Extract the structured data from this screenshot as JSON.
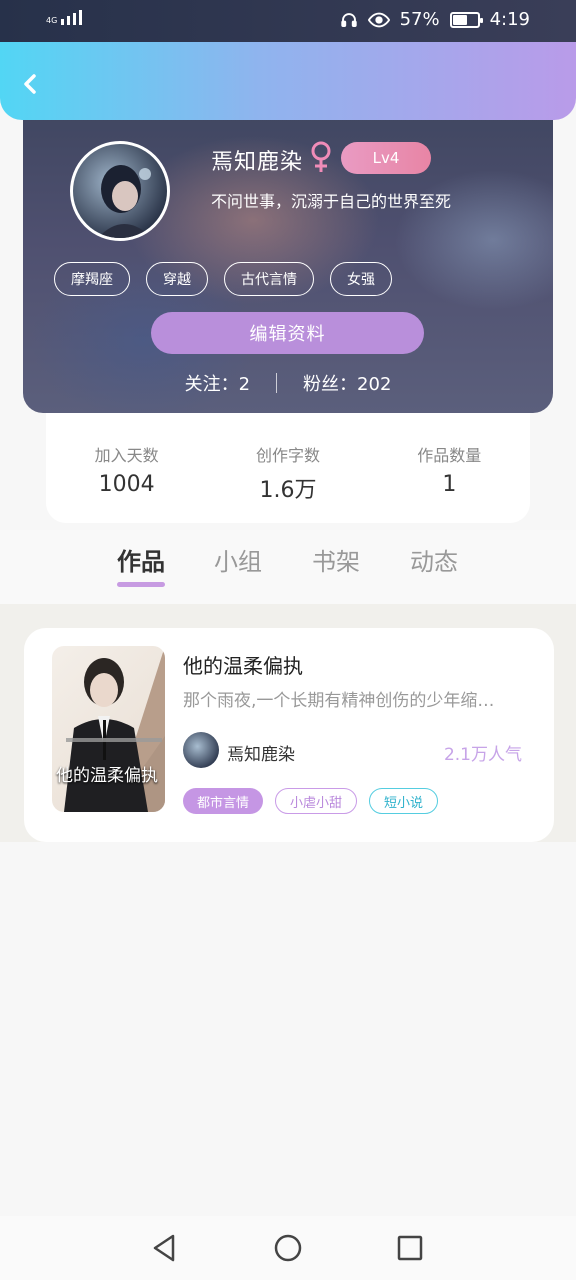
{
  "status_bar": {
    "network": "4G",
    "battery": "57%",
    "battery_level": 0.57,
    "time": "4:19"
  },
  "profile": {
    "username": "焉知鹿染",
    "level": "Lv4",
    "signature": "不问世事，沉溺于自己的世界至死",
    "tags": [
      "摩羯座",
      "穿越",
      "古代言情",
      "女强"
    ],
    "edit_button": "编辑资料",
    "following_label": "关注：2",
    "followers_label": "粉丝：202"
  },
  "stats": [
    {
      "label": "加入天数",
      "value": "1004"
    },
    {
      "label": "创作字数",
      "value": "1.6万"
    },
    {
      "label": "作品数量",
      "value": "1"
    }
  ],
  "tabs": [
    "作品",
    "小组",
    "书架",
    "动态"
  ],
  "active_tab": "作品",
  "works": [
    {
      "cover_title": "他的温柔偏执",
      "title": "他的温柔偏执",
      "description": "那个雨夜,一个长期有精神创伤的少年缩…",
      "author": "焉知鹿染",
      "popularity": "2.1万人气",
      "tags": [
        "都市言情",
        "小虐小甜",
        "短小说"
      ]
    }
  ],
  "colors": {
    "header_start": "#52d6f4",
    "header_end": "#b99be9",
    "accent_purple": "#b98fdb",
    "tab_underline": "#c79be2",
    "popularity": "#c7a4e8",
    "tag_cyan": "#2fb2cc"
  },
  "icons": [
    "back-icon",
    "female-icon",
    "headphones-icon",
    "eye-icon",
    "battery-icon",
    "nav-back-icon",
    "nav-home-icon",
    "nav-recents-icon"
  ]
}
